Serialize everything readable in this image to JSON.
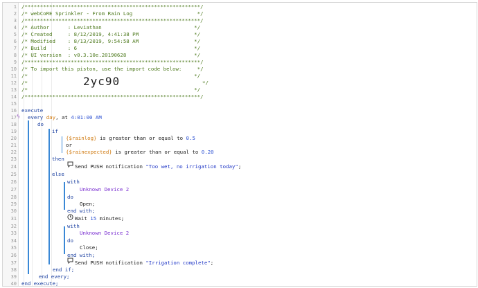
{
  "line_numbers": [
    "1",
    "2",
    "3",
    "4",
    "5",
    "6",
    "7",
    "8",
    "9",
    "10",
    "11",
    "12",
    "13",
    "14",
    "15",
    "16",
    "17",
    "18",
    "19",
    "20",
    "21",
    "22",
    "23",
    "24",
    "25",
    "26",
    "27",
    "28",
    "29",
    "30",
    "31",
    "32",
    "33",
    "34",
    "35",
    "36",
    "37",
    "38",
    "39",
    "40"
  ],
  "header": {
    "border": "/*********************************************************/",
    "title": "/* webCoRE Sprinkler - From Rain Log                     */",
    "author": "/* Author      : Leviathan                              */",
    "created": "/* Created     : 8/12/2019, 4:41:38 PM                  */",
    "modified": "/* Modified    : 8/13/2019, 9:54:58 AM                  */",
    "build": "/* Build       : 6                                      */",
    "ui_version": "/* UI version  : v0.3.10e.20190628                      */",
    "import_line": "/* To import this piston, use the import code below:     */",
    "blank": "/*                                                      */",
    "import_left": "/*",
    "import_right": "*/",
    "import_code": "2yc90"
  },
  "code": {
    "execute": "execute",
    "every": "every",
    "day": "day",
    "at": ", at",
    "time": "4:01:00 AM",
    "do": "do",
    "if": "if",
    "rainlog": "{$rainlog}",
    "gte": " is greater than or equal to ",
    "val1": "0.5",
    "or": "or",
    "rainexpected": "{$rainexpected}",
    "val2": "0.20",
    "then": "then",
    "send": "Send PUSH notification",
    "msg1": "\"Too wet, no irrigation today\"",
    "semi": ";",
    "else": "else",
    "with": "with",
    "device": "Unknown Device 2",
    "open": "Open;",
    "end_with": "end with;",
    "wait": "Wait",
    "wait_num": "15",
    "minutes": "minutes;",
    "close": "Close;",
    "msg2": "\"Irrigation complete\"",
    "end_if": "end if;",
    "end_every": "end every;",
    "end_execute": "end execute;"
  },
  "colors": {
    "comment": "#4e7a1e",
    "keyword": "#1a3fa0",
    "variable": "#d07a10",
    "number": "#2a4fd2",
    "device": "#7a2fd0",
    "block_line": "#3a88d6"
  }
}
